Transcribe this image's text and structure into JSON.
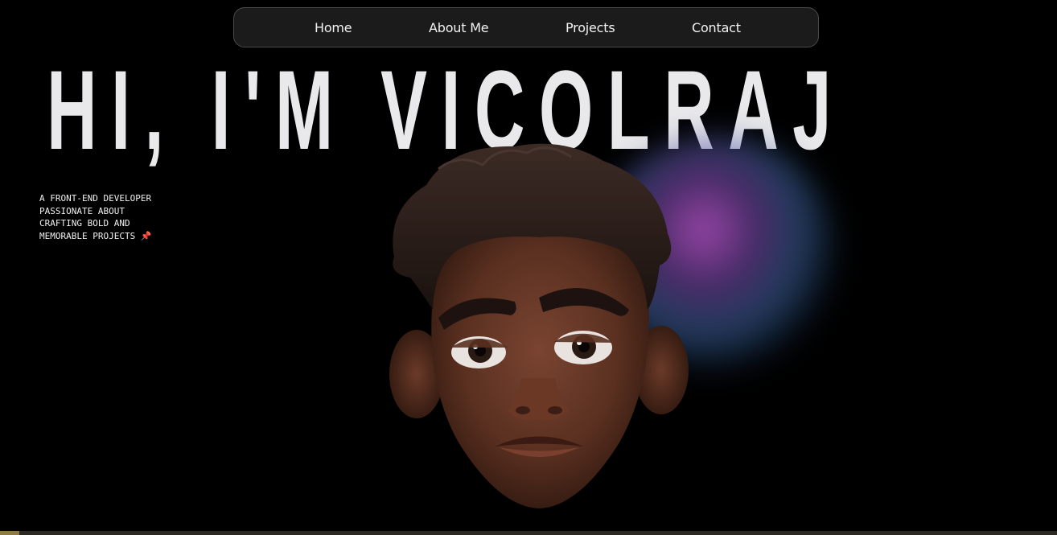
{
  "nav": {
    "items": [
      {
        "label": "Home"
      },
      {
        "label": "About Me"
      },
      {
        "label": "Projects"
      },
      {
        "label": "Contact"
      }
    ]
  },
  "hero": {
    "title": "HI, I'M VICOLRAJ",
    "tagline_lines": [
      "A FRONT-END DEVELOPER",
      "PASSIONATE ABOUT",
      "CRAFTING BOLD AND",
      "MEMORABLE PROJECTS"
    ],
    "tagline_icon": "pushpin-icon",
    "tagline_icon_glyph": "📌"
  },
  "avatar": {
    "icon": "cartoon-boy-avatar"
  },
  "colors": {
    "background": "#000000",
    "title": "#e9e8ea",
    "nav_bg": "#1b1b1b",
    "nav_border": "#4a4a4a",
    "glow_purple": "#af50be",
    "glow_blue": "#3c6eaa",
    "skin": "#5a3020"
  }
}
